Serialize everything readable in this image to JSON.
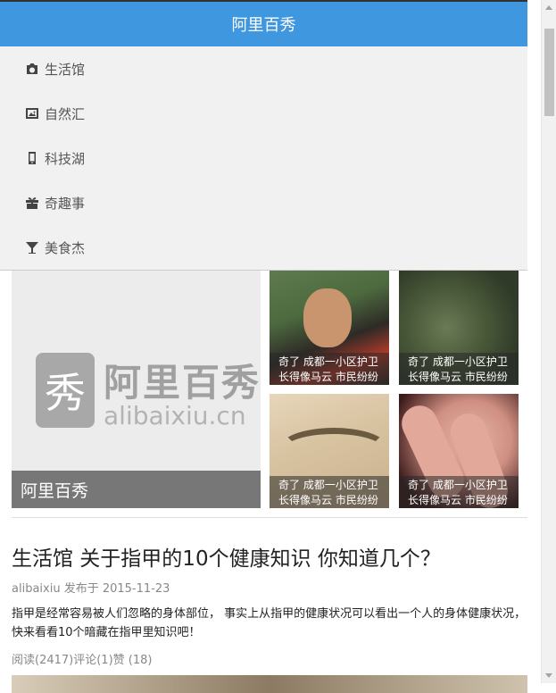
{
  "header": {
    "title": "阿里百秀"
  },
  "menu": {
    "items": [
      {
        "label": "生活馆",
        "icon": "camera-icon"
      },
      {
        "label": "自然汇",
        "icon": "picture-icon"
      },
      {
        "label": "科技湖",
        "icon": "mobile-icon"
      },
      {
        "label": "奇趣事",
        "icon": "gift-icon"
      },
      {
        "label": "美食杰",
        "icon": "cocktail-icon"
      }
    ]
  },
  "hero": {
    "logo_glyph": "秀",
    "logo_cn": "阿里百秀",
    "logo_en": "alibaixiu.cn",
    "caption": "阿里百秀"
  },
  "thumbs": [
    {
      "caption": "奇了 成都一小区护卫长得像马云 市民纷纷"
    },
    {
      "caption": "奇了 成都一小区护卫长得像马云 市民纷纷"
    },
    {
      "caption": "奇了 成都一小区护卫长得像马云 市民纷纷"
    },
    {
      "caption": "奇了 成都一小区护卫长得像马云 市民纷纷"
    }
  ],
  "article": {
    "title": "生活馆 关于指甲的10个健康知识 你知道几个？",
    "meta": "alibaixiu 发布于 2015-11-23",
    "summary": "指甲是经常容易被人们忽略的身体部位， 事实上从指甲的健康状况可以看出一个人的身体健康状况， 快来看看10个暗藏在指甲里知识吧！",
    "stats": "阅读(2417)评论(1)赞 (18)"
  },
  "colors": {
    "header_bg": "#3f97df",
    "menu_bg": "#f1f1f1"
  }
}
